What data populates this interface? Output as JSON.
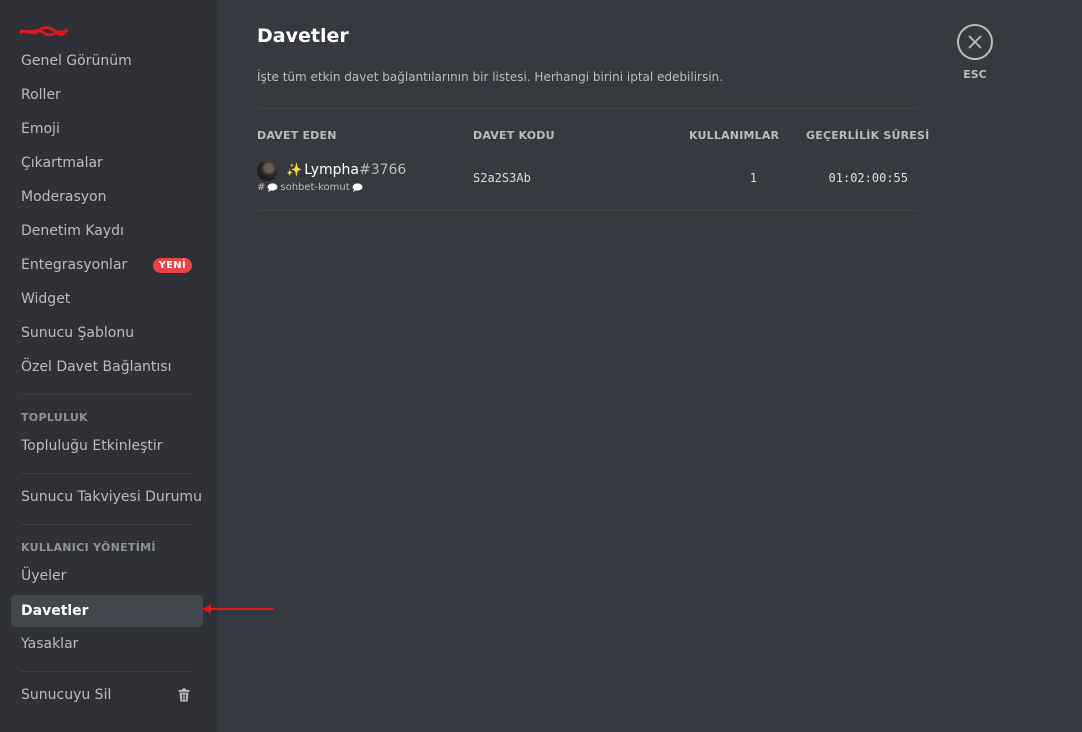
{
  "sidebar": {
    "items": [
      {
        "label": "Genel Görünüm"
      },
      {
        "label": "Roller"
      },
      {
        "label": "Emoji"
      },
      {
        "label": "Çıkartmalar"
      },
      {
        "label": "Moderasyon"
      },
      {
        "label": "Denetim Kaydı"
      },
      {
        "label": "Entegrasyonlar",
        "badge": "YENİ"
      },
      {
        "label": "Widget"
      },
      {
        "label": "Sunucu Şablonu"
      },
      {
        "label": "Özel Davet Bağlantısı"
      }
    ],
    "community_header": "TOPLULUK",
    "community_items": [
      {
        "label": "Topluluğu Etkinleştir"
      }
    ],
    "boost_item": {
      "label": "Sunucu Takviyesi Durumu"
    },
    "user_mgmt_header": "KULLANICI YÖNETİMİ",
    "user_mgmt_items": [
      {
        "label": "Üyeler"
      },
      {
        "label": "Davetler",
        "active": true
      },
      {
        "label": "Yasaklar"
      }
    ],
    "delete_item": {
      "label": "Sunucuyu Sil",
      "icon": "trash-icon"
    }
  },
  "main": {
    "title": "Davetler",
    "description": "İşte tüm etkin davet bağlantılarının bir listesi. Herhangi birini iptal edebilirsin.",
    "columns": [
      "DAVET EDEN",
      "DAVET KODU",
      "KULLANIMLAR",
      "GEÇERLİLİK SÜRESİ"
    ],
    "invites": [
      {
        "inviter_prefix": "✨",
        "inviter_name": "Lympha",
        "inviter_discriminator": "#3766",
        "channel_hash": "#",
        "channel_name": "sohbet-komut",
        "code": "S2a2S3Ab",
        "uses": "1",
        "expires": "01:02:00:55"
      }
    ]
  },
  "close": {
    "label": "ESC",
    "icon": "close-icon"
  },
  "colors": {
    "sidebar_bg": "#2f3136",
    "content_bg": "#36393f",
    "active_item_bg": "#42464d",
    "badge_red": "#ed4245",
    "annotation_red": "#e3161c"
  }
}
